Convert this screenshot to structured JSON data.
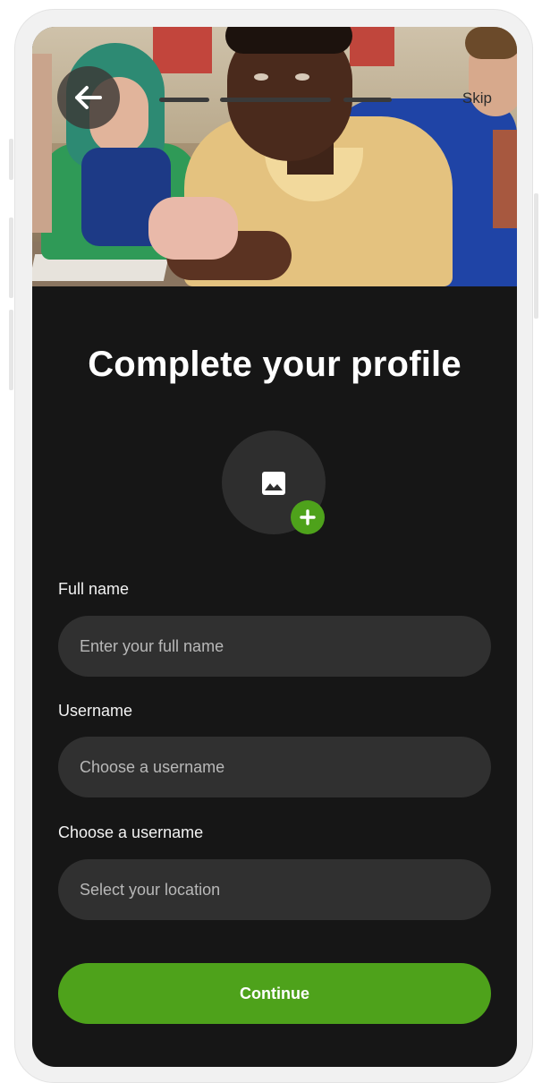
{
  "header": {
    "back_icon": "arrow-left-icon",
    "skip_label": "Skip",
    "progress_steps_total": 3,
    "progress_step_current": 1
  },
  "hero": {
    "description_icon": "hero-photo"
  },
  "title": "Complete your profile",
  "avatar": {
    "icon": "image-icon",
    "add_icon": "plus-icon"
  },
  "form": {
    "full_name": {
      "label": "Full name",
      "placeholder": "Enter your full name"
    },
    "username": {
      "label": "Username",
      "placeholder": "Choose a username"
    },
    "location": {
      "label": "Choose a username",
      "placeholder": "Select your location"
    }
  },
  "continue_label": "Continue",
  "colors": {
    "accent": "#4ea21b",
    "screen_background": "#161616",
    "field_background": "#303030",
    "text": "#ffffff",
    "placeholder": "#b8b8b8"
  }
}
